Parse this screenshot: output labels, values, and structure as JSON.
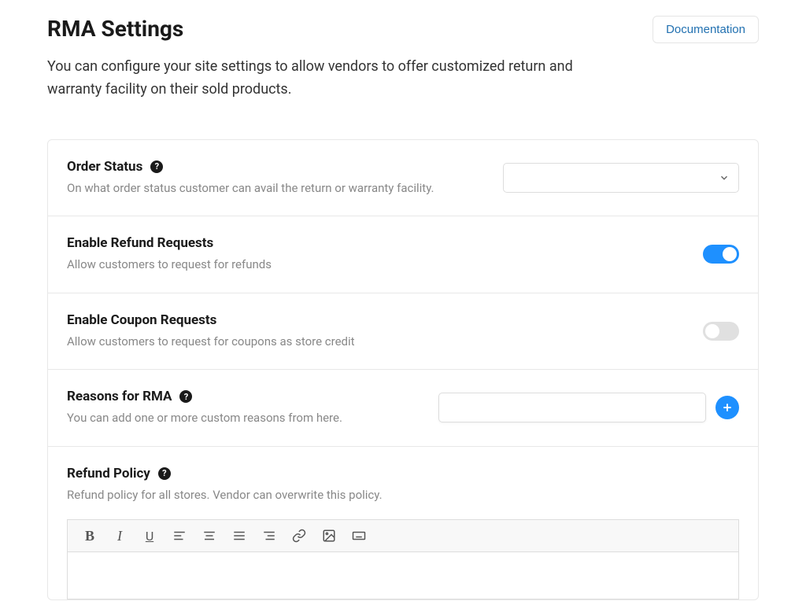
{
  "header": {
    "title": "RMA Settings",
    "documentation_label": "Documentation",
    "subtitle": "You can configure your site settings to allow vendors to offer customized return and warranty facility on their sold products."
  },
  "settings": {
    "order_status": {
      "title": "Order Status",
      "desc": "On what order status customer can avail the return or warranty facility.",
      "value": ""
    },
    "refund_requests": {
      "title": "Enable Refund Requests",
      "desc": "Allow customers to request for refunds",
      "enabled": true
    },
    "coupon_requests": {
      "title": "Enable Coupon Requests",
      "desc": "Allow customers to request for coupons as store credit",
      "enabled": false
    },
    "rma_reasons": {
      "title": "Reasons for RMA",
      "desc": "You can add one or more custom reasons from here.",
      "value": ""
    },
    "refund_policy": {
      "title": "Refund Policy",
      "desc": "Refund policy for all stores. Vendor can overwrite this policy.",
      "content": ""
    }
  },
  "help_glyph": "?",
  "colors": {
    "primary": "#1e90ff",
    "link": "#2271b1"
  }
}
